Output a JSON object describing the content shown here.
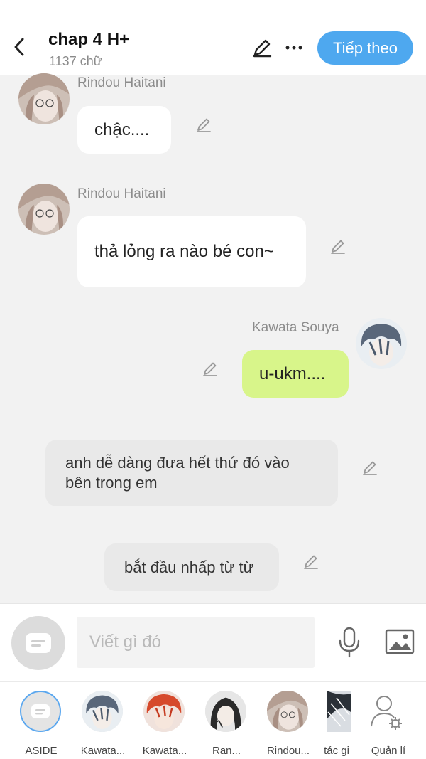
{
  "header": {
    "title": "chap 4 H+",
    "word_count": "1137 chữ",
    "next_label": "Tiếp theo"
  },
  "messages": [
    {
      "sender": "Rindou Haitani",
      "text": "chậc...."
    },
    {
      "sender": "Rindou Haitani",
      "text": "thả lỏng ra nào bé con~"
    },
    {
      "sender": "Kawata Souya",
      "text": "u-ukm...."
    },
    {
      "text": "anh dễ dàng đưa hết thứ đó vào bên trong em"
    },
    {
      "text": "bắt đầu nhấp từ từ"
    }
  ],
  "composer": {
    "placeholder": "Viết gì đó"
  },
  "characters": [
    {
      "label": "ASIDE"
    },
    {
      "label": "Kawata..."
    },
    {
      "label": "Kawata..."
    },
    {
      "label": "Ran..."
    },
    {
      "label": "Rindou..."
    },
    {
      "label": "tác gi"
    },
    {
      "label": "Quản lí"
    }
  ],
  "colors": {
    "accent": "#4ea8ef",
    "own_bubble": "#d8f58a",
    "background": "#f2f2f2"
  }
}
